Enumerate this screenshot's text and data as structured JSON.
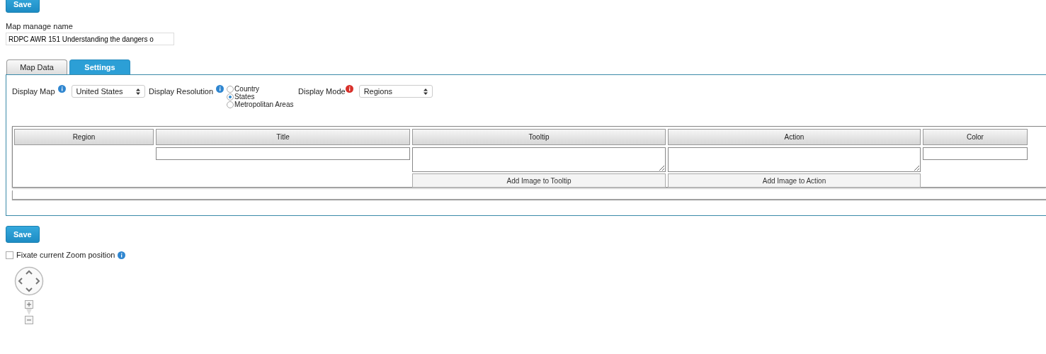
{
  "top_button": "Save",
  "name_field": {
    "label": "Map manage name",
    "value": "RDPC AWR 151 Understanding the dangers o"
  },
  "tabs": [
    {
      "label": "Map Data",
      "selected": false
    },
    {
      "label": "Settings",
      "selected": true
    }
  ],
  "settings": {
    "display_map": {
      "label": "Display Map",
      "kind": "info",
      "value": "United States"
    },
    "display_resolution": {
      "label": "Display Resolution",
      "kind": "info",
      "options": [
        {
          "label": "Country",
          "selected": false
        },
        {
          "label": "States",
          "selected": true
        },
        {
          "label": "Metropolitan Areas",
          "selected": false
        }
      ]
    },
    "display_mode": {
      "label": "Display Mode",
      "kind": "alert",
      "value": "Regions"
    }
  },
  "table": {
    "columns": [
      "Region",
      "Title",
      "Tooltip",
      "Action",
      "Color"
    ],
    "row": [
      {
        "kind": "empty"
      },
      {
        "kind": "input"
      },
      {
        "kind": "textarea",
        "button": "Add Image to Tooltip"
      },
      {
        "kind": "textarea",
        "button": "Add Image to Action"
      },
      {
        "kind": "input"
      }
    ]
  },
  "bottom_button": "Save",
  "fixate": {
    "label": "Fixate current Zoom position",
    "kind": "info",
    "checked": false
  }
}
